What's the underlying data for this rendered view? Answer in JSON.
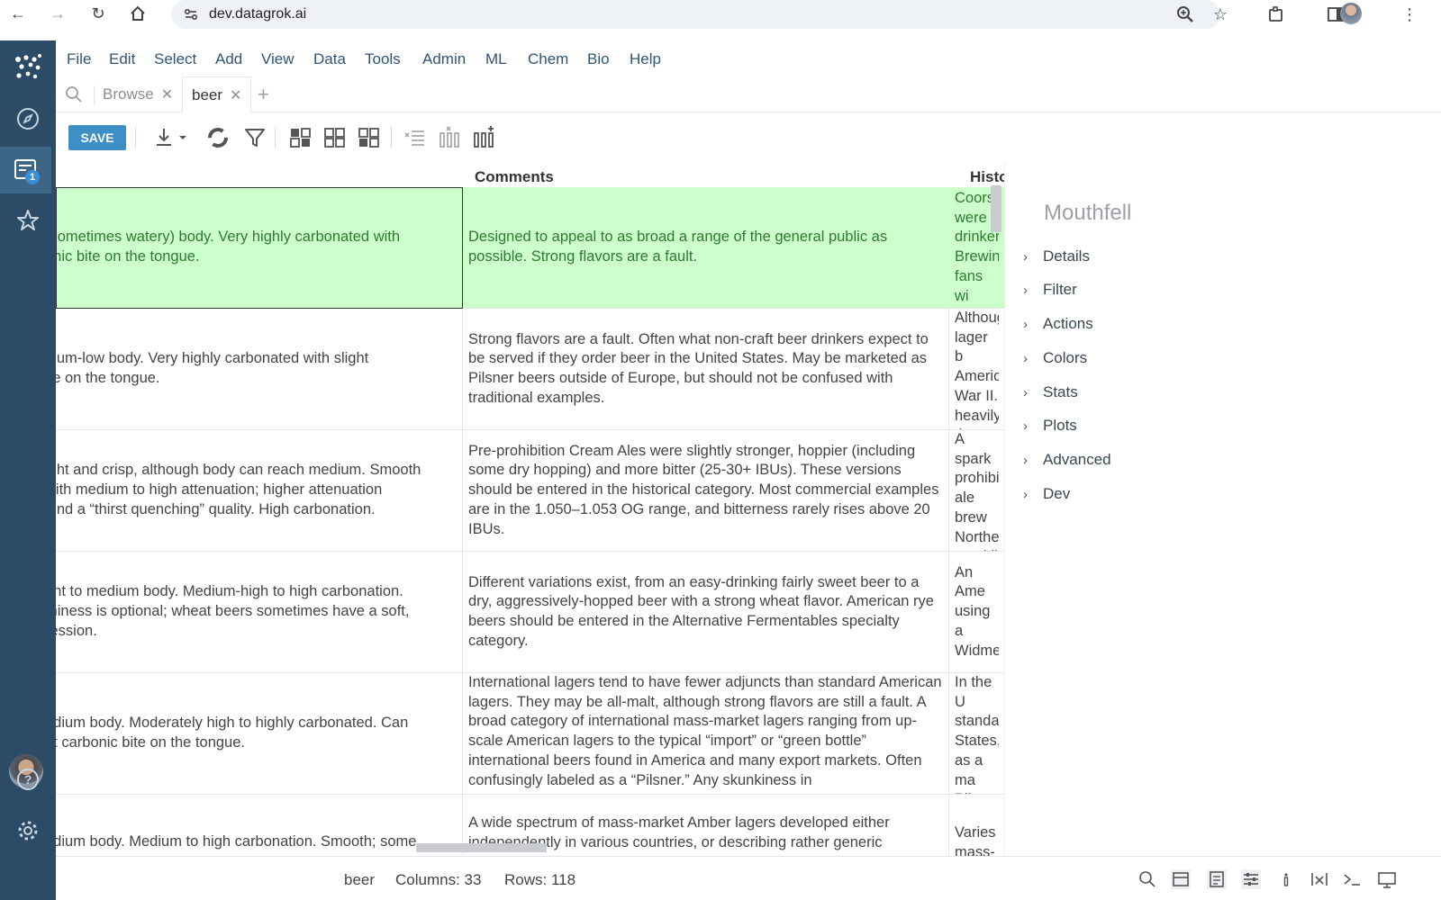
{
  "browser": {
    "url": "dev.datagrok.ai"
  },
  "sidebar": {
    "badge_count": "1"
  },
  "menu": {
    "items": [
      "File",
      "Edit",
      "Select",
      "Add",
      "View",
      "Data",
      "Tools",
      "Admin",
      "ML",
      "Chem",
      "Bio",
      "Help"
    ]
  },
  "tabs": [
    {
      "label": "Browse",
      "active": false
    },
    {
      "label": "beer",
      "active": true
    }
  ],
  "toolbar": {
    "save_label": "SAVE"
  },
  "grid": {
    "columns": [
      "Comments",
      "History"
    ],
    "rows": [
      {
        "mouthfeel": "(sometimes watery) body. Very highly carbonated with\nonic bite on the tongue.",
        "comments": "Designed to appeal to as broad a range of the general public as possible. Strong flavors are a fault.",
        "history": "Coors\nwere\ndrinker\nBrewin\nfans wi\nbecam",
        "selected": true
      },
      {
        "mouthfeel": "dium-low body. Very highly carbonated with slight\nite on the tongue.",
        "comments": "Strong flavors are a fault. Often what non-craft beer drinkers expect to be served if they order beer in the United States. May be marketed as Pilsner beers outside of Europe, but should not be confused with traditional examples.",
        "history": "Althoug\nlager b\nAmeric\nWar II.\nheavily\nthe pop",
        "selected": false
      },
      {
        "mouthfeel": "ight and crisp, although body can reach medium. Smooth\nwith medium to high attenuation; higher attenuation\nlend a “thirst quenching” quality. High carbonation.",
        "comments": "Pre-prohibition Cream Ales were slightly stronger, hoppier (including some dry hopping) and more bitter (25-30+ IBUs). These versions should be entered in the historical category. Most commercial examples are in the 1.050–1.053 OG range, and bitterness rarely rises above 20 IBUs.",
        "history": "A spark\nprohibi\nale brew\nNorthe\nsparklin\nare) us",
        "selected": false
      },
      {
        "mouthfeel": "ght to medium body. Medium-high to high carbonation.\nminess is optional; wheat beers sometimes have a soft,\nression.",
        "comments": "Different variations exist, from an easy-drinking fairly sweet beer to a dry, aggressively-hopped beer with a strong wheat flavor. American rye beers should be entered in the Alternative Fermentables specialty category.",
        "history": "An Ame\nusing a\nWidme",
        "selected": false
      },
      {
        "mouthfeel": "edium body. Moderately high to highly carbonated. Can\nht carbonic bite on the tongue.",
        "comments": "International lagers tend to have fewer adjuncts than standard American lagers. They may be all-malt, although strong flavors are still a fault. A broad category of international mass-market lagers ranging from up-scale American lagers to the typical “import” or “green bottle” international beers found in America and many export markets. Often confusingly labeled as a “Pilsner.” Any skunkiness in",
        "history": "In the U\nstanda\nStates,\nas a ma\nPilsner\nindustr",
        "selected": false
      },
      {
        "mouthfeel": "edium body. Medium to high carbonation. Smooth; some",
        "comments": "A wide spectrum of mass-market Amber lagers developed either independently in various countries, or describing rather generic",
        "history": "Varies\nmass-m",
        "selected": false
      }
    ]
  },
  "context_panel": {
    "title": "Mouthfell",
    "sections": [
      "Details",
      "Filter",
      "Actions",
      "Colors",
      "Stats",
      "Plots",
      "Advanced",
      "Dev"
    ]
  },
  "statusbar": {
    "table_name": "beer",
    "columns_text": "Columns: 33",
    "rows_text": "Rows: 118"
  },
  "colors": {
    "sidebar_bg": "#2b4b66",
    "accent": "#3d8fc6",
    "selected_row": "#ccffcc"
  }
}
